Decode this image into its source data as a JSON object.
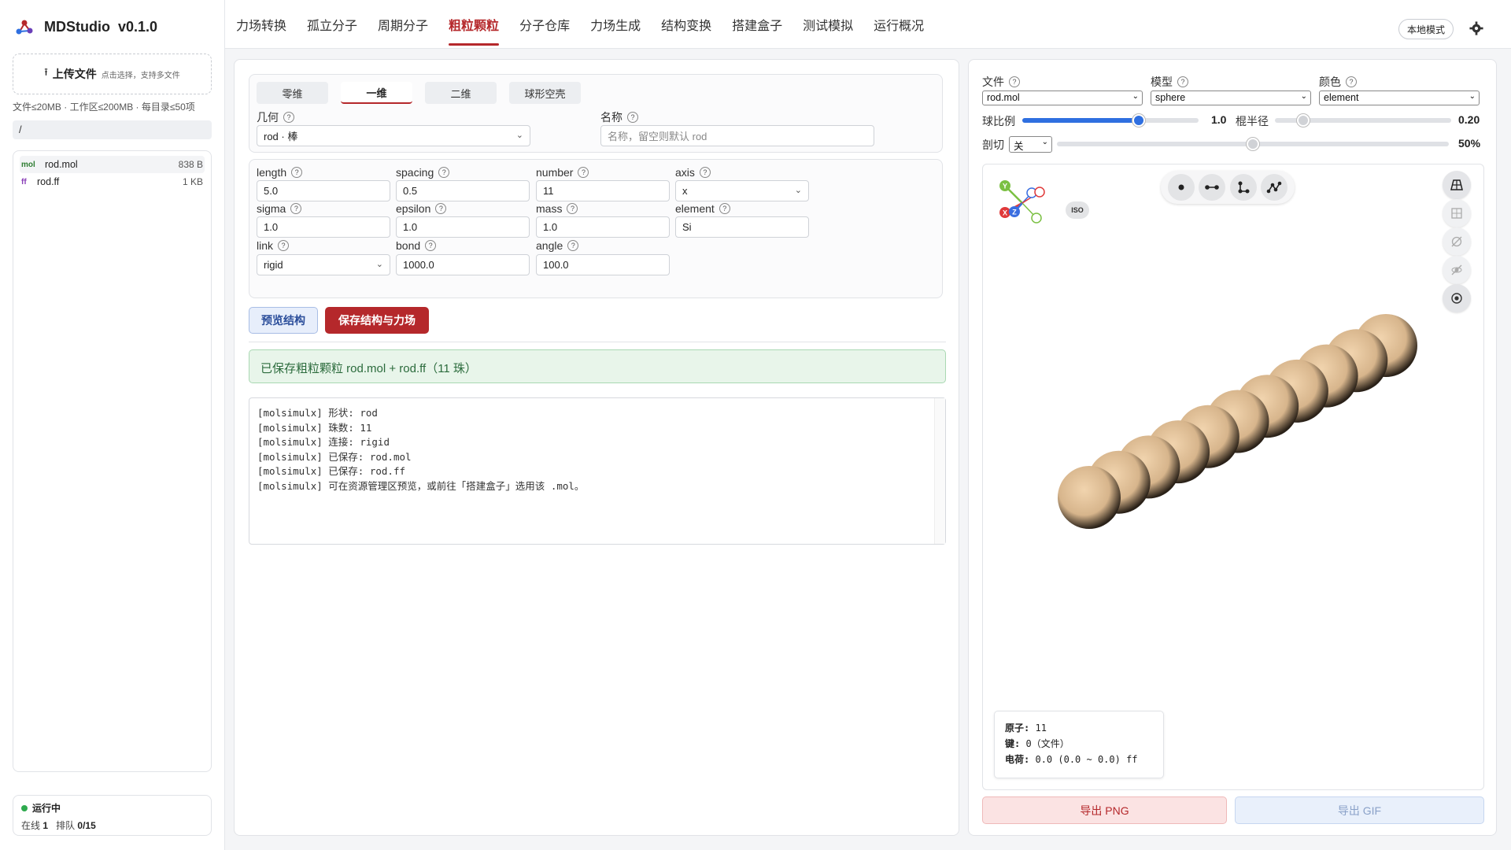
{
  "app": {
    "name": "MDStudio",
    "version": "v0.1.0"
  },
  "sidebar": {
    "upload_label": "上传文件",
    "upload_hint": "点击选择，支持多文件",
    "limits": "文件≤20MB · 工作区≤200MB · 每目录≤50项",
    "path": "/",
    "files": [
      {
        "tag": "mol",
        "name": "rod.mol",
        "size": "838 B"
      },
      {
        "tag": "ff",
        "name": "rod.ff",
        "size": "1 KB"
      }
    ],
    "status": {
      "state": "运行中",
      "online_label": "在线",
      "online": "1",
      "queue_label": "排队",
      "queue": "0/15"
    }
  },
  "nav": {
    "tabs": [
      "力场转换",
      "孤立分子",
      "周期分子",
      "粗粒颗粒",
      "分子仓库",
      "力场生成",
      "结构变换",
      "搭建盒子",
      "测试模拟",
      "运行概况"
    ],
    "active_tab": 3,
    "mode_label": "本地模式"
  },
  "form": {
    "subtabs": [
      "零维",
      "一维",
      "二维",
      "球形空壳"
    ],
    "active_subtab": 1,
    "geometry": {
      "label": "几何",
      "value": "rod · 棒"
    },
    "name": {
      "label": "名称",
      "placeholder": "名称，留空则默认 rod"
    },
    "params": {
      "length": {
        "label": "length",
        "value": "5.0"
      },
      "spacing": {
        "label": "spacing",
        "value": "0.5"
      },
      "number": {
        "label": "number",
        "value": "11"
      },
      "axis": {
        "label": "axis",
        "value": "x"
      },
      "sigma": {
        "label": "sigma",
        "value": "1.0"
      },
      "epsilon": {
        "label": "epsilon",
        "value": "1.0"
      },
      "mass": {
        "label": "mass",
        "value": "1.0"
      },
      "element": {
        "label": "element",
        "value": "Si"
      },
      "link": {
        "label": "link",
        "value": "rigid"
      },
      "bond": {
        "label": "bond",
        "value": "1000.0"
      },
      "angle": {
        "label": "angle",
        "value": "100.0"
      }
    },
    "preview_btn": "预览结构",
    "save_btn": "保存结构与力场",
    "success_msg": "已保存粗粒颗粒 rod.mol + rod.ff（11 珠）",
    "log_lines": [
      "[molsimulx] 形状: rod",
      "[molsimulx] 珠数: 11",
      "[molsimulx] 连接: rigid",
      "[molsimulx] 已保存: rod.mol",
      "[molsimulx] 已保存: rod.ff",
      "[molsimulx] 可在资源管理区预览，或前往「搭建盒子」选用该 .mol。"
    ]
  },
  "viewer": {
    "file_label": "文件",
    "file_value": "rod.mol",
    "model_label": "模型",
    "model_value": "sphere",
    "color_label": "颜色",
    "color_value": "element",
    "ball_scale_label": "球比例",
    "ball_scale_value": "1.0",
    "ball_scale_fraction": 0.66,
    "stick_radius_label": "棍半径",
    "stick_radius_value": "0.20",
    "stick_radius_fraction": 0.16,
    "clip_label": "剖切",
    "clip_value": "关",
    "clip_percent_value": "50%",
    "clip_fraction": 0.5,
    "iso_label": "ISO",
    "axes": {
      "x": "X",
      "y": "Y",
      "z": "Z"
    },
    "bead_color": "#d7b58c",
    "bead_count": 11,
    "info": {
      "atoms_label": "原子:",
      "atoms_value": "11",
      "bonds_label": "键:",
      "bonds_value": "0（文件）",
      "charge_label": "电荷:",
      "charge_value": "0.0 (0.0 ~ 0.0) ff"
    },
    "export_png": "导出 PNG",
    "export_gif": "导出 GIF"
  }
}
